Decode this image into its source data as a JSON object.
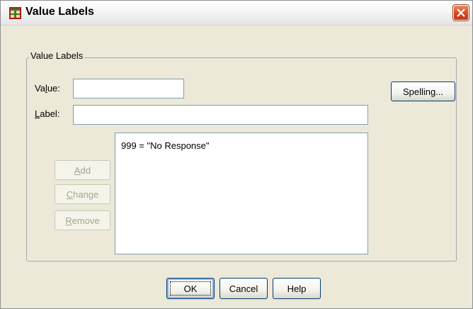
{
  "window": {
    "title": "Value Labels",
    "icon": "spss-value-labels-icon"
  },
  "group": {
    "label": "Value Labels"
  },
  "fields": {
    "value_label": "Value:",
    "value_text": "",
    "label_label": "Label:",
    "label_text": ""
  },
  "list": {
    "items": [
      "999 = \"No Response\""
    ]
  },
  "buttons": {
    "spelling": "Spelling...",
    "add": "Add",
    "change": "Change",
    "remove": "Remove",
    "ok": "OK",
    "cancel": "Cancel",
    "help": "Help"
  },
  "colors": {
    "dialog_bg": "#ece9d8",
    "close_red": "#d4461c",
    "input_border": "#7f9db9"
  }
}
